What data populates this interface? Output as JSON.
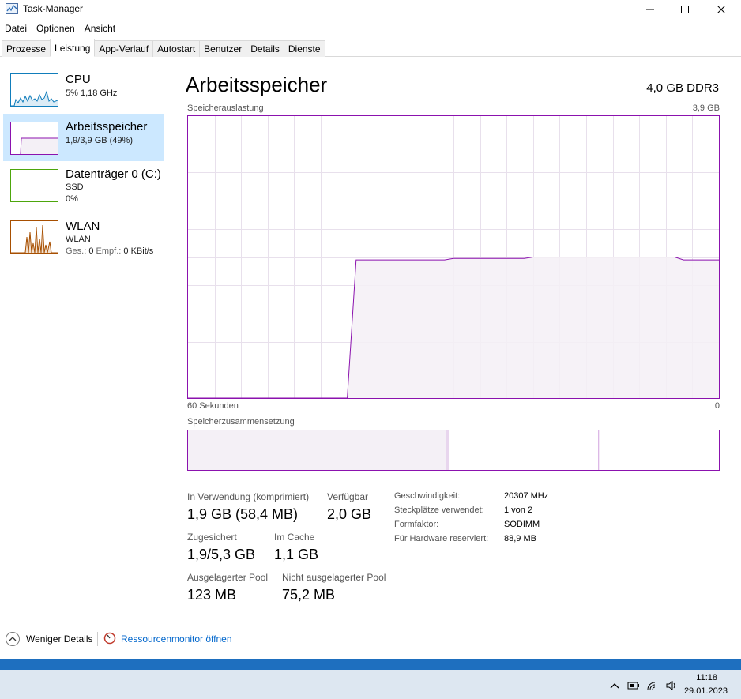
{
  "window": {
    "title": "Task-Manager"
  },
  "menu": [
    "Datei",
    "Optionen",
    "Ansicht"
  ],
  "tabs": [
    "Prozesse",
    "Leistung",
    "App-Verlauf",
    "Autostart",
    "Benutzer",
    "Details",
    "Dienste"
  ],
  "active_tab": "Leistung",
  "sidebar": {
    "items": [
      {
        "title": "CPU",
        "line1": "5%  1,18 GHz",
        "line2": "",
        "icon": "cpu-graph"
      },
      {
        "title": "Arbeitsspeicher",
        "line1": "1,9/3,9 GB (49%)",
        "line2": "",
        "icon": "memory-graph"
      },
      {
        "title": "Datenträger 0 (C:)",
        "line1": "SSD",
        "line2": "0%",
        "icon": "disk-graph"
      },
      {
        "title": "WLAN",
        "line1": "WLAN",
        "line2_label_send": "Ges.:",
        "line2_send": "0",
        "line2_label_recv": "Empf.:",
        "line2_recv": "0 KBit/s",
        "icon": "wlan-graph"
      }
    ]
  },
  "main": {
    "title": "Arbeitsspeicher",
    "spec": "4,0 GB DDR3",
    "usage_label": "Speicherauslastung",
    "usage_max": "3,9 GB",
    "time_left": "60 Sekunden",
    "time_right": "0",
    "composition_label": "Speicherzusammensetzung",
    "stats": {
      "in_use_label": "In Verwendung (komprimiert)",
      "in_use_value": "1,9 GB (58,4 MB)",
      "available_label": "Verfügbar",
      "available_value": "2,0 GB",
      "committed_label": "Zugesichert",
      "committed_value": "1,9/5,3 GB",
      "cached_label": "Im Cache",
      "cached_value": "1,1 GB",
      "paged_label": "Ausgelagerter Pool",
      "paged_value": "123 MB",
      "nonpaged_label": "Nicht ausgelagerter Pool",
      "nonpaged_value": "75,2 MB"
    },
    "details": [
      {
        "label": "Geschwindigkeit:",
        "value": "20307 MHz"
      },
      {
        "label": "Steckplätze verwendet:",
        "value": "1 von 2"
      },
      {
        "label": "Formfaktor:",
        "value": "SODIMM"
      },
      {
        "label": "Für Hardware reserviert:",
        "value": "88,9 MB"
      }
    ]
  },
  "chart_data": {
    "type": "area",
    "x_label_left": "60 Sekunden",
    "x_label_right": "0",
    "y_max_label": "3,9 GB",
    "usage_fraction": [
      0,
      0,
      0,
      0,
      0,
      0,
      0,
      0,
      0,
      0,
      0,
      0,
      0,
      0,
      0,
      0,
      0,
      0,
      0,
      0.49,
      0.49,
      0.49,
      0.49,
      0.49,
      0.49,
      0.49,
      0.49,
      0.49,
      0.49,
      0.49,
      0.495,
      0.495,
      0.495,
      0.495,
      0.495,
      0.495,
      0.495,
      0.495,
      0.495,
      0.5,
      0.5,
      0.5,
      0.5,
      0.5,
      0.5,
      0.5,
      0.5,
      0.5,
      0.5,
      0.5,
      0.5,
      0.5,
      0.5,
      0.5,
      0.5,
      0.5,
      0.49,
      0.49,
      0.49,
      0.49,
      0.49
    ],
    "composition_fractions": {
      "in_use": 0.486,
      "modified": 0.006,
      "standby": 0.282,
      "free": 0.226
    },
    "colors": {
      "line": "#8b12ae",
      "fill": "#f4f0f6",
      "grid": "#e8e0ec"
    }
  },
  "footer": {
    "fewer_details": "Weniger Details",
    "resource_monitor": "Ressourcenmonitor öffnen"
  },
  "taskbar": {
    "time": "11:18",
    "date": "29.01.2023"
  }
}
